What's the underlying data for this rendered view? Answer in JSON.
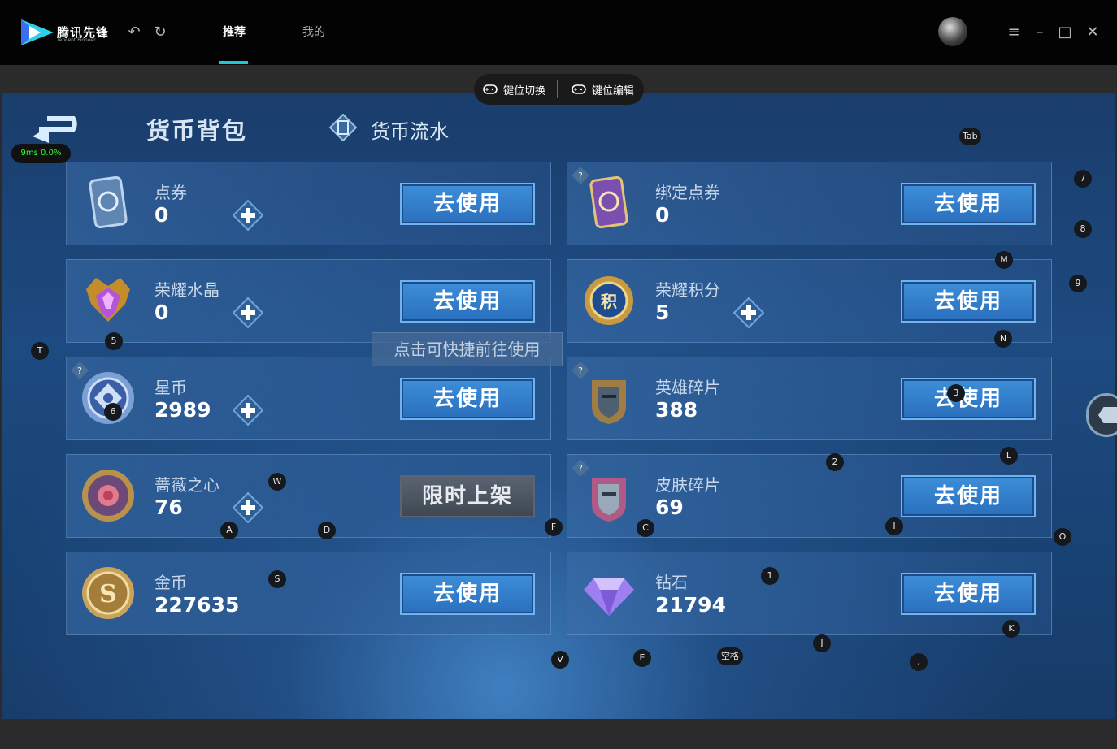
{
  "app": {
    "name": "腾讯先锋",
    "subtitle": "Tencent Pioneer"
  },
  "titlebar": {
    "tabs": [
      {
        "label": "推荐",
        "active": true
      },
      {
        "label": "我的",
        "active": false
      }
    ],
    "accent": "#1fc8d8"
  },
  "keyboard_pill": {
    "switch_label": "键位切换",
    "edit_label": "键位编辑"
  },
  "ping": {
    "text": "9ms  0.0%"
  },
  "page": {
    "title": "货币背包",
    "flow_tab": "货币流水"
  },
  "tooltip": "点击可快捷前往使用",
  "use_label": "去使用",
  "limited_label": "限时上架",
  "cards": [
    {
      "name": "点券",
      "value": "0",
      "icon": "coupon-card-icon"
    },
    {
      "name": "绑定点券",
      "value": "0",
      "icon": "bound-coupon-card-icon"
    },
    {
      "name": "荣耀水晶",
      "value": "0",
      "icon": "glory-crystal-icon"
    },
    {
      "name": "荣耀积分",
      "value": "5",
      "icon": "glory-points-icon"
    },
    {
      "name": "星币",
      "value": "2989",
      "icon": "star-coin-icon"
    },
    {
      "name": "英雄碎片",
      "value": "388",
      "icon": "hero-fragment-icon"
    },
    {
      "name": "蔷薇之心",
      "value": "76",
      "icon": "rose-heart-icon"
    },
    {
      "name": "皮肤碎片",
      "value": "69",
      "icon": "skin-fragment-icon"
    },
    {
      "name": "金币",
      "value": "227635",
      "icon": "gold-coin-icon"
    },
    {
      "name": "钻石",
      "value": "21794",
      "icon": "diamond-icon"
    }
  ],
  "keys": [
    "Tab",
    "7",
    "8",
    "M",
    "9",
    "5",
    "T",
    "N",
    "6",
    "3",
    "L",
    "2",
    "W",
    "A",
    "D",
    "F",
    "C",
    "I",
    "O",
    "S",
    "1",
    "K",
    "J",
    "V",
    "E",
    "空格",
    ","
  ]
}
